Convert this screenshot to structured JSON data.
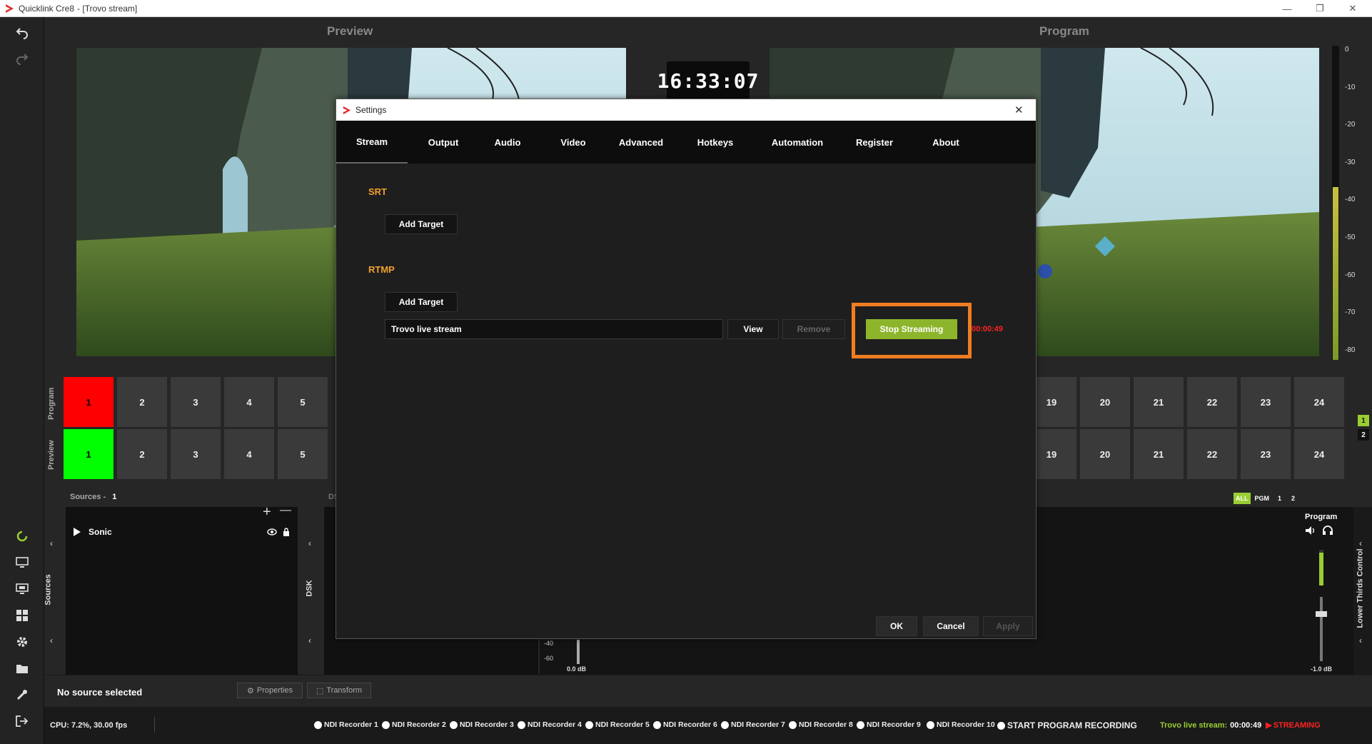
{
  "window": {
    "app_title": "Quicklink Cre8",
    "doc_title": "- [Trovo stream]",
    "minimize_glyph": "—",
    "restore_glyph": "❐",
    "close_glyph": "✕"
  },
  "left_toolbar": {
    "icons": [
      "undo-icon",
      "redo-icon",
      "refresh-icon",
      "monitor-icon",
      "screen-icon",
      "grid-icon",
      "gear-icon",
      "folder-icon",
      "tools-icon",
      "exit-icon"
    ]
  },
  "preview": {
    "title": "Preview"
  },
  "program": {
    "title": "Program"
  },
  "clock": {
    "time": "16:33:07"
  },
  "meter": {
    "ticks": [
      "0",
      "-10",
      "-20",
      "-30",
      "-40",
      "-50",
      "-60",
      "-70",
      "-80"
    ],
    "level": 0.55
  },
  "switcher": {
    "program_label": "Program",
    "preview_label": "Preview",
    "left_buttons": [
      "1",
      "2",
      "3",
      "4",
      "5"
    ],
    "right_buttons": [
      "19",
      "20",
      "21",
      "22",
      "23",
      "24"
    ],
    "active_program_color": "#ff0000",
    "active_preview_color": "#00ff00",
    "page_buttons": [
      "1",
      "2"
    ]
  },
  "sources": {
    "header_label": "Sources",
    "count_separator": "-",
    "count": "1",
    "tab_label": "Sources",
    "items": [
      {
        "name": "Sonic"
      }
    ],
    "add_glyph": "+",
    "remove_glyph": "—"
  },
  "dsk": {
    "tab_label": "DSK",
    "header_label": "DS"
  },
  "audio_filter": {
    "options": [
      "ALL",
      "PGM",
      "1",
      "2"
    ],
    "active": "ALL"
  },
  "mixer": {
    "program_label": "Program",
    "ticks": [
      "-40",
      "-60"
    ],
    "left_value": "0.0 dB",
    "right_value": "-1.0 dB",
    "lower_thirds_label": "Lower Thirds Control"
  },
  "properties_bar": {
    "no_source": "No source selected",
    "properties": "Properties",
    "transform": "Transform"
  },
  "status": {
    "cpu": "CPU: 7.2%, 30.00 fps",
    "recorders": [
      "NDI Recorder 1",
      "NDI Recorder 2",
      "NDI Recorder 3",
      "NDI Recorder 4",
      "NDI Recorder 5",
      "NDI Recorder 6",
      "NDI Recorder 7",
      "NDI Recorder 8",
      "NDI Recorder 9",
      "NDI Recorder 10"
    ],
    "start_program_recording": "START PROGRAM RECORDING",
    "stream_label": "Trovo live stream:",
    "stream_time": "00:00:49",
    "streaming": "STREAMING",
    "accent_green": "#9acd32",
    "streaming_red": "#ff2222"
  },
  "settings_dialog": {
    "title": "Settings",
    "close_glyph": "✕",
    "tabs": [
      "Stream",
      "Output",
      "Audio",
      "Video",
      "Advanced",
      "Hotkeys",
      "Automation",
      "Register",
      "About"
    ],
    "active_tab": "Stream",
    "srt": {
      "label": "SRT",
      "add_target": "Add Target"
    },
    "rtmp": {
      "label": "RTMP",
      "add_target": "Add Target",
      "target_name": "Trovo live stream",
      "view": "View",
      "remove": "Remove",
      "stop_streaming": "Stop Streaming",
      "elapsed": "00:00:49"
    },
    "ok": "OK",
    "cancel": "Cancel",
    "apply": "Apply",
    "highlight_color": "#f07d22",
    "stop_button_color": "#8db52c"
  }
}
